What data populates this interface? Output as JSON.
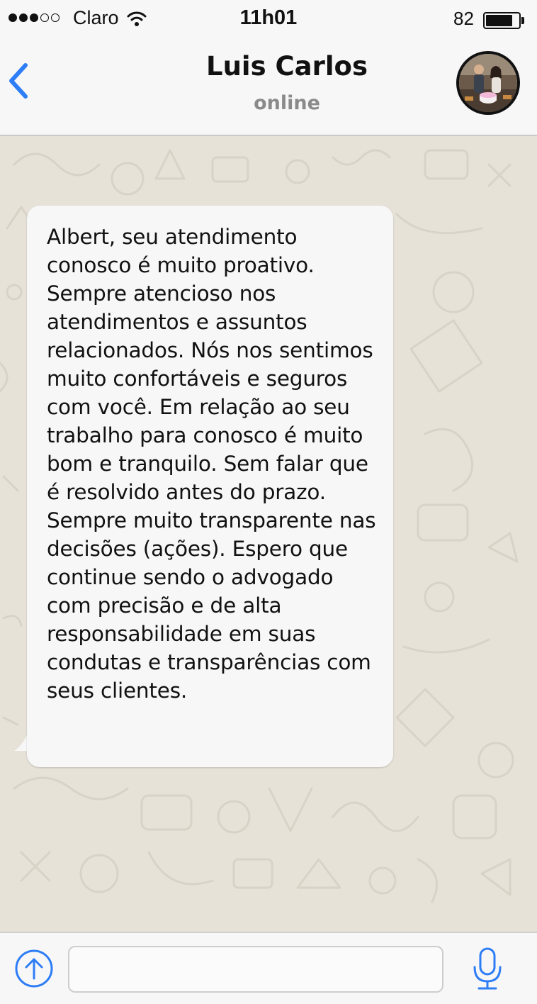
{
  "status_bar": {
    "carrier": "Claro",
    "time": "11h01",
    "battery_level": "82",
    "signal_bars_filled": 3,
    "signal_bars_total": 5,
    "battery_fill_fraction": 0.82
  },
  "header": {
    "contact_name": "Luis Carlos",
    "contact_status": "online",
    "back_icon": "chevron-left-icon",
    "avatar_icon": "contact-avatar"
  },
  "chat": {
    "messages": [
      {
        "direction": "incoming",
        "text": "Albert, seu atendimento conosco é muito proativo. Sempre atencioso nos atendimentos e assuntos relacionados. Nós nos sentimos muito confortáveis e seguros com você. Em relação ao seu trabalho para conosco é muito bom e tranquilo. Sem falar que é resolvido antes do prazo. Sempre muito transparente nas decisões (ações). Espero que continue sendo o advogado com precisão e de alta responsabilidade em suas condutas e transparências com seus clientes."
      }
    ]
  },
  "input_bar": {
    "message_value": "",
    "attach_icon": "upload-arrow-icon",
    "mic_icon": "microphone-icon"
  },
  "colors": {
    "accent": "#2d7df6",
    "chat_background": "#e6e2d8",
    "bubble": "#f7f7f7",
    "bar_background": "#f7f7f7"
  }
}
